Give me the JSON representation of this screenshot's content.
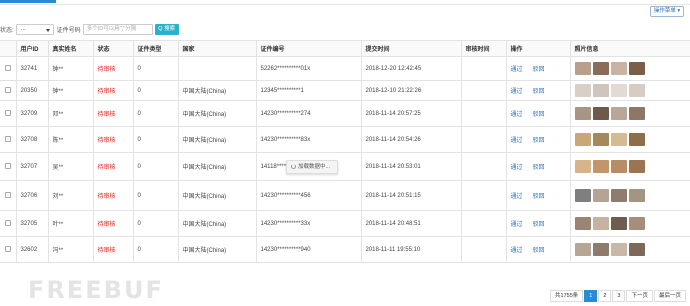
{
  "toolbar": {
    "op_button": "操作菜单 ▾"
  },
  "filter": {
    "status_label": "状态:",
    "status_value": "...",
    "id_label": "证件号码",
    "id_placeholder": "多个ID可以用\",\"分隔",
    "search_label": "Q 搜索"
  },
  "table": {
    "headers": [
      "",
      "用户ID",
      "真实姓名",
      "状态",
      "证件类型",
      "国家",
      "证件编号",
      "提交时间",
      "审核时间",
      "操作",
      "照片信息"
    ],
    "rows": [
      {
        "id": "32741",
        "name": "钟**",
        "status": "待审核",
        "type": "0",
        "country": "",
        "number": "52262**********01x",
        "submitted": "2018-12-20 12:42:45",
        "reviewed": "",
        "approve": "通过",
        "reject": "驳回"
      },
      {
        "id": "20350",
        "name": "钟**",
        "status": "待审核",
        "type": "0",
        "country": "中国大陆(China)",
        "number": "12345**********1",
        "submitted": "2018-12-10 21:22:26",
        "reviewed": "",
        "approve": "通过",
        "reject": "驳回"
      },
      {
        "id": "32709",
        "name": "邓**",
        "status": "待审核",
        "type": "0",
        "country": "中国大陆(China)",
        "number": "14230**********274",
        "submitted": "2018-11-14 20:57:25",
        "reviewed": "",
        "approve": "通过",
        "reject": "驳回"
      },
      {
        "id": "32708",
        "name": "陈**",
        "status": "待审核",
        "type": "0",
        "country": "中国大陆(China)",
        "number": "14230**********83x",
        "submitted": "2018-11-14 20:54:26",
        "reviewed": "",
        "approve": "通过",
        "reject": "驳回"
      },
      {
        "id": "32707",
        "name": "吴**",
        "status": "待审核",
        "type": "0",
        "country": "中国大陆(China)",
        "number": "14118**********042",
        "submitted": "2018-11-14 20:53:01",
        "reviewed": "",
        "approve": "通过",
        "reject": "驳回"
      },
      {
        "id": "32706",
        "name": "刘**",
        "status": "待审核",
        "type": "0",
        "country": "中国大陆(China)",
        "number": "14230**********456",
        "submitted": "2018-11-14 20:51:15",
        "reviewed": "",
        "approve": "通过",
        "reject": "驳回"
      },
      {
        "id": "32705",
        "name": "叶**",
        "status": "待审核",
        "type": "0",
        "country": "中国大陆(China)",
        "number": "14230**********33x",
        "submitted": "2018-11-14 20:48:51",
        "reviewed": "",
        "approve": "通过",
        "reject": "驳回"
      },
      {
        "id": "32602",
        "name": "冯**",
        "status": "待审核",
        "type": "0",
        "country": "中国大陆(China)",
        "number": "14230**********940",
        "submitted": "2018-11-11 19:55:10",
        "reviewed": "",
        "approve": "通过",
        "reject": "驳回"
      }
    ]
  },
  "loading": "加载数据中...",
  "pager": {
    "total": "共1755条",
    "pages": [
      "1",
      "2",
      "3"
    ],
    "next": "下一页",
    "last": "最后一页"
  },
  "watermark": "FREEBUF",
  "thumb_colors": [
    [
      "#b9a08c",
      "#8a6c58",
      "#c9b3a3",
      "#7b5d4a"
    ],
    [
      "#d8cfc8",
      "#cfc5bd",
      "#e2dad3",
      "#d6ccc4"
    ],
    [
      "#a89484",
      "#6d5a4c",
      "#b8a698",
      "#8d7766"
    ],
    [
      "#c9a878",
      "#a6885c",
      "#d4bb95",
      "#8c6f4a"
    ],
    [
      "#d8b48c",
      "#c2956a",
      "#b88c64",
      "#9c7451"
    ],
    [
      "#7f7f7f",
      "#b5a496",
      "#8e7d6e",
      "#a69483"
    ],
    [
      "#9a8574",
      "#c6b2a0",
      "#6f5c4e",
      "#a48e7c"
    ],
    [
      "#b7a596",
      "#8f7b6b",
      "#c9b8aa",
      "#7d6959"
    ]
  ]
}
